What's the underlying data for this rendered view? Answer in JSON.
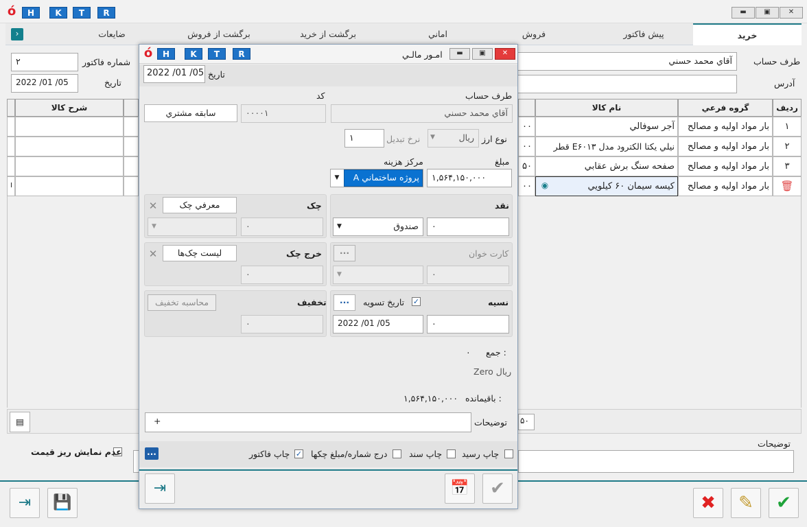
{
  "app": {
    "hotkeys": [
      "H",
      "K",
      "T",
      "R"
    ]
  },
  "tabs": [
    {
      "label": "خريد"
    },
    {
      "label": "پيش فاکتور"
    },
    {
      "label": "فروش"
    },
    {
      "label": "اماني"
    },
    {
      "label": "برگشت از خريد"
    },
    {
      "label": "برگشت از فروش"
    },
    {
      "label": "ضايعات"
    }
  ],
  "header": {
    "account_label": "طرف حساب",
    "account_value": "آقاي محمد حسني",
    "address_label": "آدرس",
    "invoice_no_label": "شماره فاکتور",
    "invoice_no_value": "۲",
    "date_label": "تاريخ",
    "date_value": "2022   /01   /05"
  },
  "grid": {
    "columns": [
      "رديف",
      "گروه فرعي",
      "نام کالا",
      "شرح کالا"
    ],
    "rows": [
      {
        "row": "۱",
        "group": "بار مواد اوليه و مصالح",
        "item": "آجر سوفالي",
        "amount": "۰۰"
      },
      {
        "row": "۲",
        "group": "بار مواد اوليه و مصالح",
        "item": "نيلي يکتا الکترود مدل E۶۰۱۳ قطر",
        "amount": "۰۰"
      },
      {
        "row": "۳",
        "group": "بار مواد اوليه و مصالح",
        "item": "صفحه سنگ برش عقابي",
        "amount": "۵۰"
      },
      {
        "row": "",
        "group": "بار مواد اوليه و مصالح",
        "item": "کيسه سيمان ۶۰ کيلويي",
        "amount": "۰۰"
      }
    ],
    "footer_amount": "۵۰"
  },
  "bottom": {
    "notes_label": "توضيحات",
    "hide_price_label": "عدم نمايش ريز قيمت"
  },
  "dialog": {
    "title": "امـور مالـي",
    "date_label": "تاريخ",
    "date_value": "2022 /01 /05",
    "account_label": "طرف حساب",
    "account_value": "آقاي محمد حسني",
    "code_label": "کد",
    "code_value": "۰۰۰۰۱",
    "history_button": "سابقه مشتري",
    "currency_label": "نوع ارز",
    "currency_value": "ريال",
    "rate_label": "نرخ تبديل",
    "rate_value": "۱",
    "amount_label": "مبلغ",
    "amount_value": "۱,۵۶۴,۱۵۰,۰۰۰",
    "cost_center_label": "مرکز هزينه",
    "cost_center_value": "پروژه ساختماني A",
    "cash_label": "نقد",
    "cash_value": "۰",
    "cash_box": "صندوق",
    "cheque_label": "چک",
    "cheque_intro_button": "معرفي چک",
    "cheque_value": "۰",
    "card_label": "کارت خوان",
    "card_value": "۰",
    "cheque_out_label": "خرج چک",
    "cheque_list_button": "ليست چک‌ها",
    "cheque_out_value": "۰",
    "credit_label": "نسيه",
    "credit_value": "۰",
    "settle_date_label": "تاريخ تسويه",
    "settle_date_value": "2022      /01      /05",
    "discount_label": "تخفيف",
    "discount_calc_button": "محاسبه تخفيف",
    "discount_value": "۰",
    "total_label": "جمع :",
    "total_value": "۰",
    "total_words": "Zero ريال",
    "remain_label": "باقيمانده :",
    "remain_value": "۱,۵۶۴,۱۵۰,۰۰۰",
    "notes_label": "توضيحات",
    "notes_add": "+",
    "print_receipt": "چاپ رسيد",
    "print_doc": "چاپ سند",
    "insert_cheque": "درج شماره/مبلغ چکها",
    "print_invoice": "چاپ فاکتور",
    "more": "..."
  }
}
